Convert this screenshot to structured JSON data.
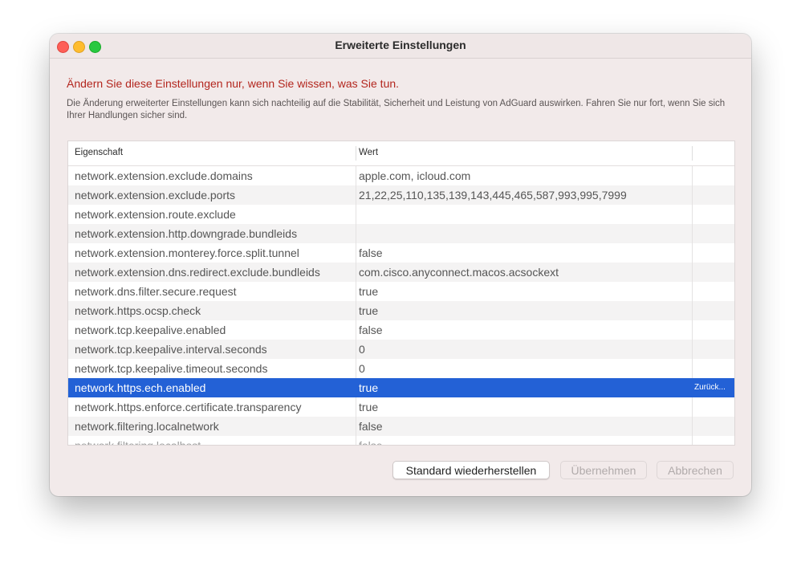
{
  "window": {
    "title": "Erweiterte Einstellungen"
  },
  "warning": "Ändern Sie diese Einstellungen nur, wenn Sie wissen, was Sie tun.",
  "description": "Die Änderung erweiterter Einstellungen kann sich nachteilig auf die Stabilität, Sicherheit und Leistung von AdGuard auswirken. Fahren Sie nur fort, wenn Sie sich Ihrer Handlungen sicher sind.",
  "table": {
    "headers": {
      "property": "Eigenschaft",
      "value": "Wert"
    },
    "rows": [
      {
        "property": "network.extension.exclude.domains",
        "value": "apple.com, icloud.com"
      },
      {
        "property": "network.extension.exclude.ports",
        "value": "21,22,25,110,135,139,143,445,465,587,993,995,7999"
      },
      {
        "property": "network.extension.route.exclude",
        "value": ""
      },
      {
        "property": "network.extension.http.downgrade.bundleids",
        "value": ""
      },
      {
        "property": "network.extension.monterey.force.split.tunnel",
        "value": "false"
      },
      {
        "property": "network.extension.dns.redirect.exclude.bundleids",
        "value": "com.cisco.anyconnect.macos.acsockext"
      },
      {
        "property": "network.dns.filter.secure.request",
        "value": "true"
      },
      {
        "property": "network.https.ocsp.check",
        "value": "true"
      },
      {
        "property": "network.tcp.keepalive.enabled",
        "value": "false"
      },
      {
        "property": "network.tcp.keepalive.interval.seconds",
        "value": "0"
      },
      {
        "property": "network.tcp.keepalive.timeout.seconds",
        "value": "0"
      },
      {
        "property": "network.https.ech.enabled",
        "value": "true",
        "selected": true,
        "reset_label": "Zurück..."
      },
      {
        "property": "network.https.enforce.certificate.transparency",
        "value": "true"
      },
      {
        "property": "network.filtering.localnetwork",
        "value": "false"
      },
      {
        "property": "network.filtering.localhost",
        "value": "false"
      }
    ]
  },
  "buttons": {
    "restore_default": "Standard wiederherstellen",
    "apply": "Übernehmen",
    "cancel": "Abbrechen"
  },
  "colors": {
    "warning": "#b3261e",
    "selection": "#2361d6"
  }
}
